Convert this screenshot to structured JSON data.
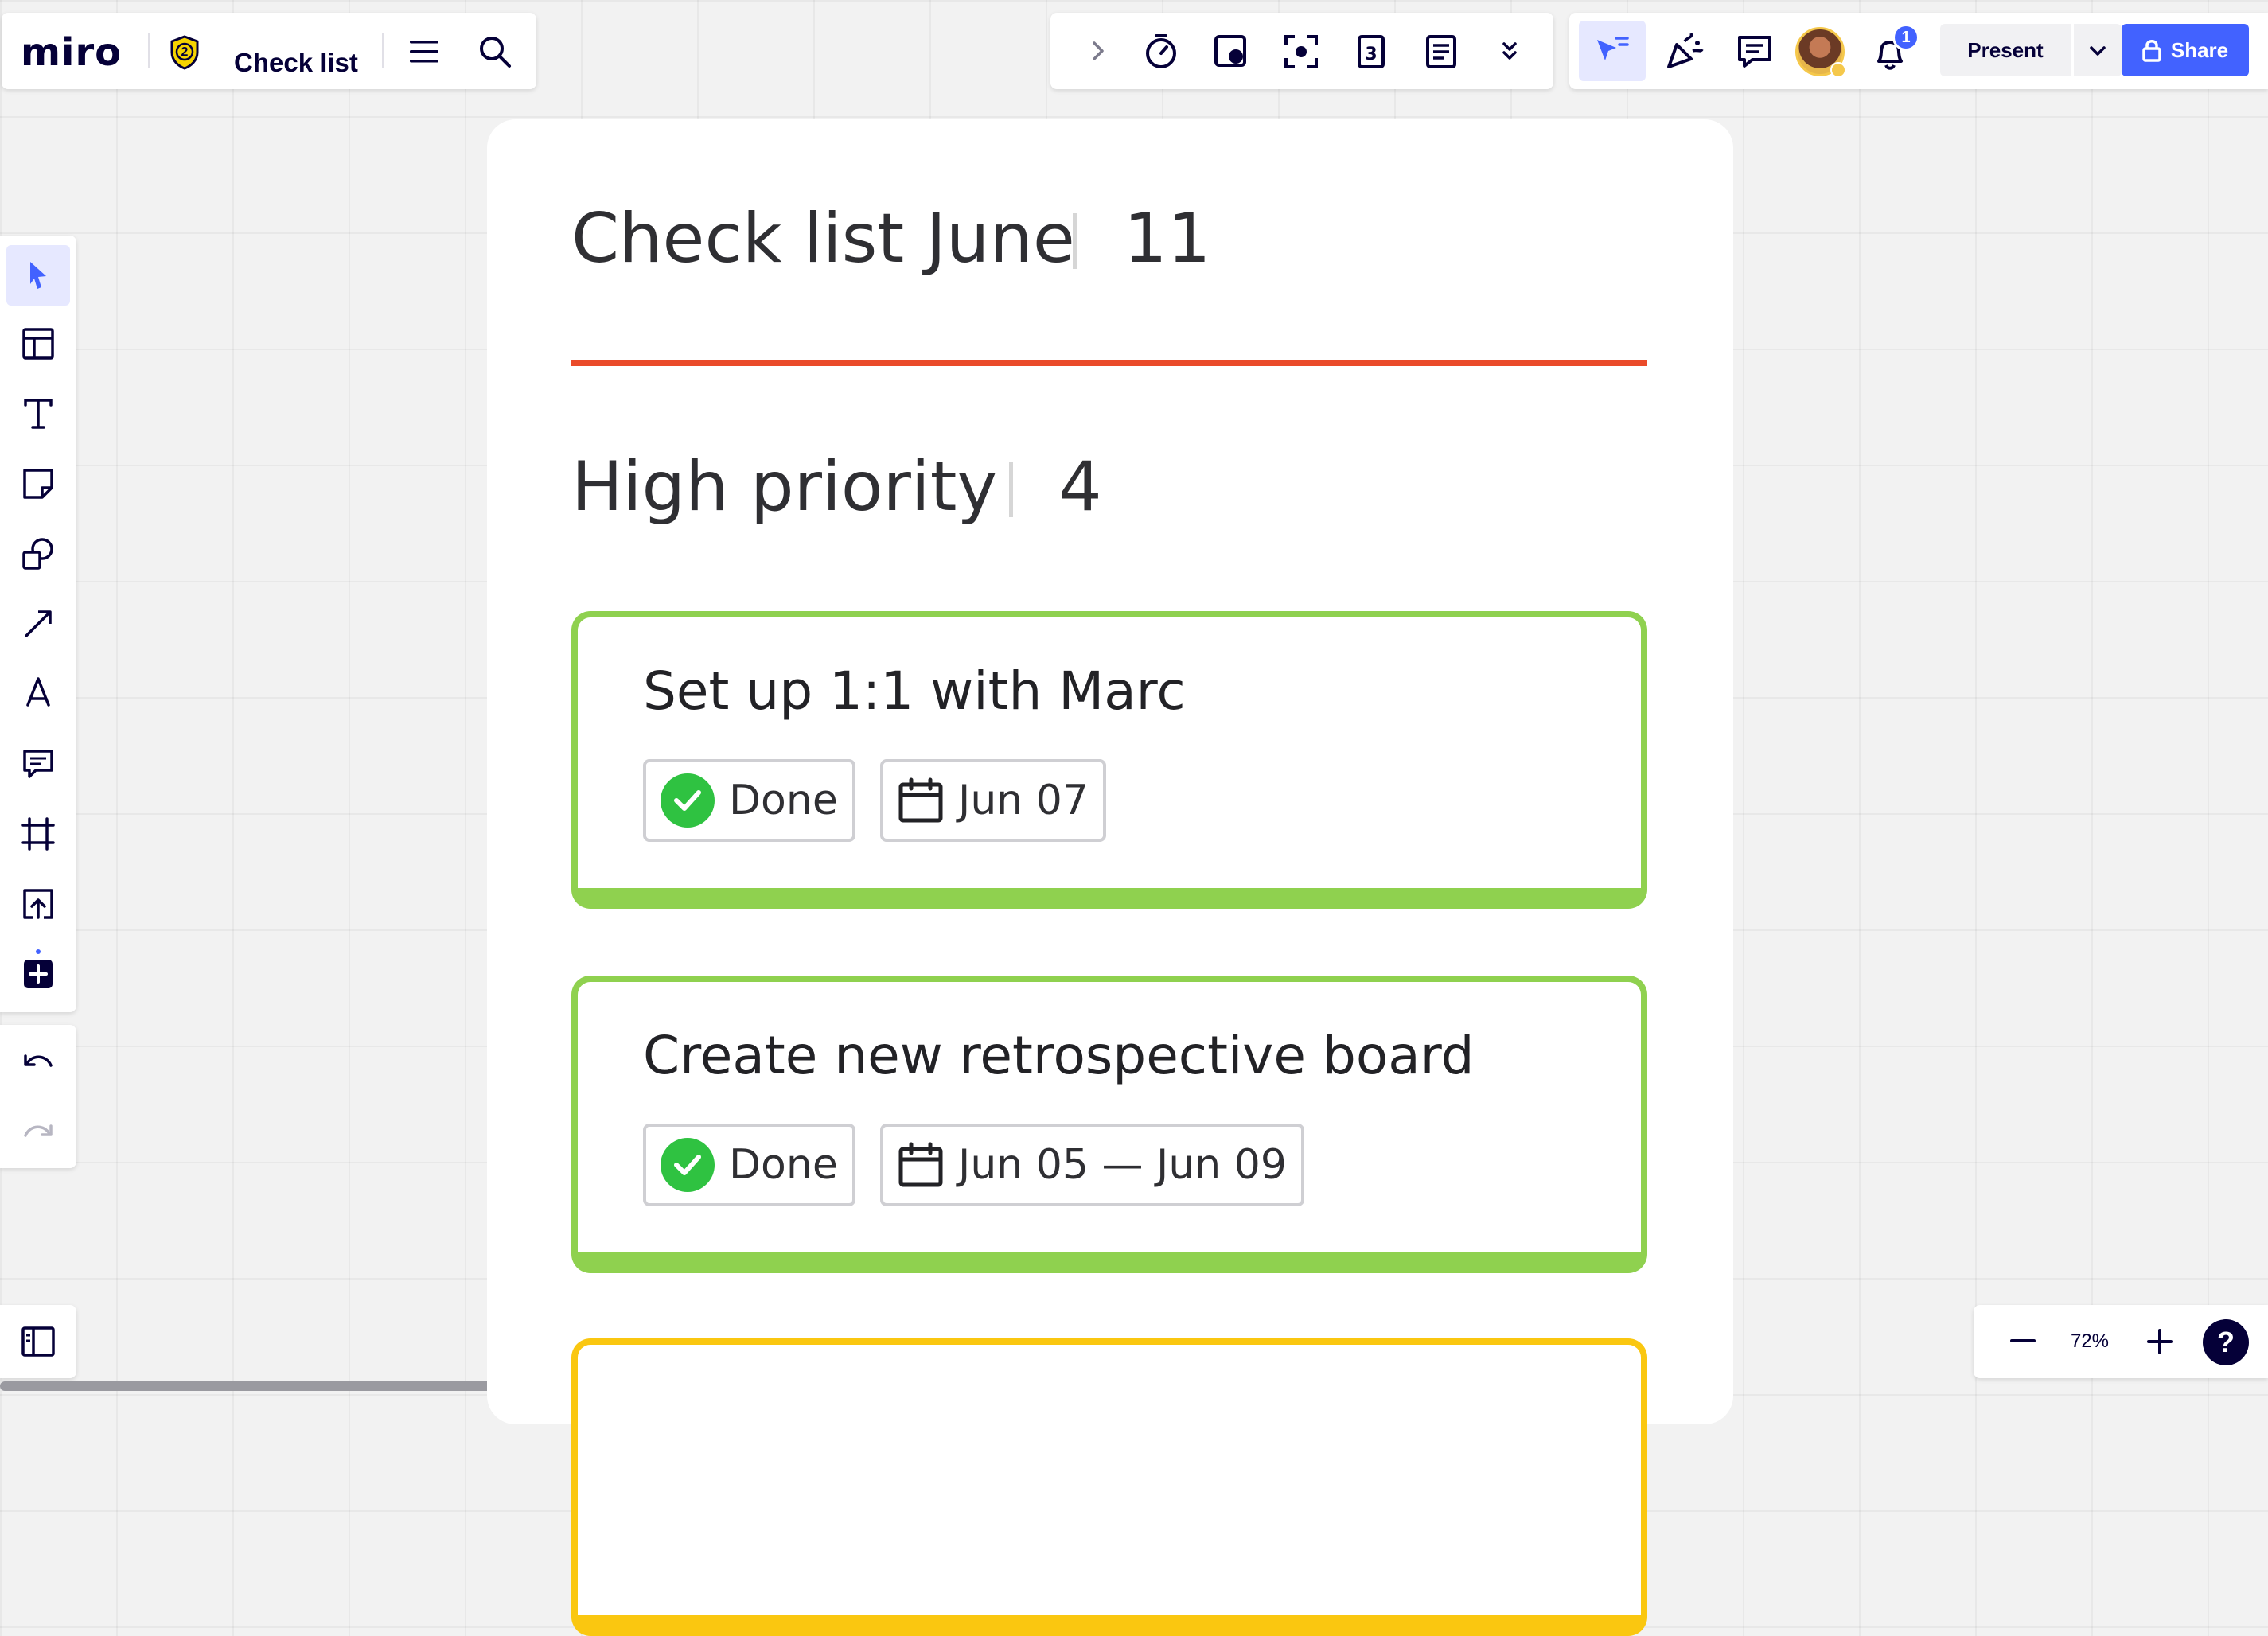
{
  "app": {
    "logo": "miro",
    "board_title": "Check list",
    "plan_badge": "2"
  },
  "toolbar_right": {
    "notification_count": "1",
    "present_label": "Present",
    "share_label": "Share"
  },
  "zoom": {
    "level": "72%",
    "help": "?"
  },
  "board": {
    "list_title": "Check list June",
    "list_count": "11",
    "section_title": "High priority",
    "section_count": "4",
    "tasks": [
      {
        "title": "Set up 1:1 with Marc",
        "status": "Done",
        "date": "Jun 07",
        "color": "#8fd14f"
      },
      {
        "title": "Create new retrospective board",
        "status": "Done",
        "date": "Jun 05 — Jun 09",
        "color": "#8fd14f"
      },
      {
        "title": "",
        "status": "",
        "date": "",
        "color": "#fac710"
      }
    ],
    "accent_line_color": "#ea4b2a"
  },
  "colors": {
    "brand": "#4262ff",
    "ink": "#050038",
    "done_green": "#2fc241"
  }
}
